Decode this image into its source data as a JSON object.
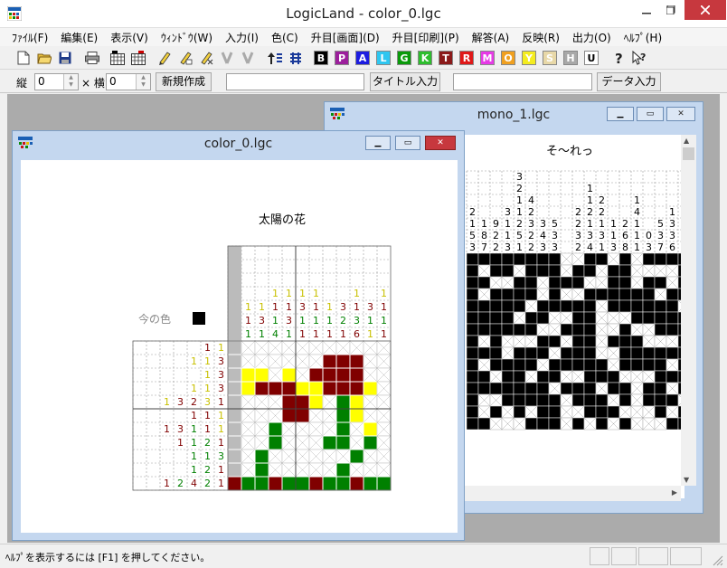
{
  "app": {
    "title": "LogicLand - color_0.lgc"
  },
  "menu": [
    "ﾌｧｲﾙ(F)",
    "編集(E)",
    "表示(V)",
    "ｳｨﾝﾄﾞｳ(W)",
    "入力(I)",
    "色(C)",
    "升目[画面](D)",
    "升目[印刷](P)",
    "解答(A)",
    "反映(R)",
    "出力(O)",
    "ﾍﾙﾌﾟ(H)"
  ],
  "color_buttons": [
    {
      "letter": "B",
      "color": "#000000"
    },
    {
      "letter": "P",
      "color": "#9c1f9c"
    },
    {
      "letter": "A",
      "color": "#1c1ce0"
    },
    {
      "letter": "L",
      "color": "#2ec6f0"
    },
    {
      "letter": "G",
      "color": "#0a9a0a"
    },
    {
      "letter": "K",
      "color": "#2ebd2e"
    },
    {
      "letter": "T",
      "color": "#8b1a1a"
    },
    {
      "letter": "R",
      "color": "#e01818"
    },
    {
      "letter": "M",
      "color": "#e63ae6"
    },
    {
      "letter": "O",
      "color": "#f0a020"
    },
    {
      "letter": "Y",
      "color": "#f4ec20"
    },
    {
      "letter": "S",
      "color": "#e8d8a8"
    },
    {
      "letter": "H",
      "color": "#a8a8a8"
    },
    {
      "letter": "U",
      "color": "#ffffff"
    }
  ],
  "toolbar2": {
    "tate_label": "縦",
    "tate_value": "0",
    "yoko_label": "× 横",
    "yoko_value": "0",
    "new_button": "新規作成",
    "title_input_button": "タイトル入力",
    "data_input_button": "データ入力"
  },
  "mono": {
    "window_title": "mono_1.lgc",
    "puzzle_title": "そ～れっ",
    "col_clue_rows": [
      [
        "",
        "",
        "",
        "",
        "3",
        "",
        "",
        "",
        "",
        "",
        "",
        "",
        "",
        "",
        "",
        "",
        "",
        "",
        ""
      ],
      [
        "",
        "",
        "",
        "",
        "2",
        "",
        "",
        "",
        "",
        "",
        "1",
        "",
        "",
        "",
        "",
        "",
        "",
        "",
        ""
      ],
      [
        "",
        "",
        "",
        "",
        "1",
        "4",
        "",
        "",
        "",
        "",
        "1",
        "2",
        "",
        "",
        "1",
        "",
        "",
        "",
        ""
      ],
      [
        "2",
        "",
        "",
        "3",
        "1",
        "2",
        "",
        "",
        "",
        "2",
        "2",
        "2",
        "",
        "",
        "4",
        "",
        "",
        "1",
        "1",
        "2"
      ],
      [
        "1",
        "1",
        "9",
        "1",
        "2",
        "3",
        "3",
        "5",
        "",
        "2",
        "1",
        "1",
        "1",
        "2",
        "1",
        "",
        "5",
        "3",
        "3"
      ],
      [
        "5",
        "8",
        "2",
        "1",
        "5",
        "2",
        "4",
        "3",
        "",
        "3",
        "3",
        "3",
        "1",
        "6",
        "1",
        "0",
        "3",
        "3"
      ],
      [
        "3",
        "7",
        "2",
        "3",
        "1",
        "2",
        "3",
        "3",
        "",
        "2",
        "4",
        "1",
        "3",
        "8",
        "1",
        "3",
        "7",
        "6"
      ]
    ],
    "cells": [
      "1111111100110101111",
      "1011011101101100001",
      "1100110111001101101",
      "1011110100111111011",
      "1111101111101111110",
      "1111011001100011111",
      "1111110011100100111",
      "1010001101101110001",
      "1110111011100111111",
      "1011110111110111101",
      "1101101100111000111",
      "1111111011101101101",
      "1001111101110101110",
      "1010101100111000101",
      "1100011101010100011"
    ]
  },
  "color": {
    "window_title": "color_0.lgc",
    "puzzle_title": "太陽の花",
    "current_color_label": "今の色",
    "current_color": "#000000",
    "palette": {
      "Y": "#ffff00",
      "T": "#800000",
      "G": "#008000",
      "H": "#bbbbbb",
      "W": "#ffffff"
    },
    "col_clues": [
      [],
      [
        {
          "v": "1",
          "c": "Y"
        },
        {
          "v": "1",
          "c": "T"
        },
        {
          "v": "1",
          "c": "G"
        }
      ],
      [
        {
          "v": "1",
          "c": "Y"
        },
        {
          "v": "3",
          "c": "T"
        },
        {
          "v": "1",
          "c": "G"
        }
      ],
      [
        {
          "v": "1",
          "c": "Y"
        },
        {
          "v": "1",
          "c": "T"
        },
        {
          "v": "1",
          "c": "G"
        },
        {
          "v": "4",
          "c": "G"
        }
      ],
      [
        {
          "v": "1",
          "c": "Y"
        },
        {
          "v": "1",
          "c": "T"
        },
        {
          "v": "3",
          "c": "T"
        },
        {
          "v": "1",
          "c": "G"
        }
      ],
      [
        {
          "v": "1",
          "c": "Y"
        },
        {
          "v": "3",
          "c": "T"
        },
        {
          "v": "1",
          "c": "G"
        },
        {
          "v": "1",
          "c": "T"
        }
      ],
      [
        {
          "v": "1",
          "c": "Y"
        },
        {
          "v": "1",
          "c": "T"
        },
        {
          "v": "1",
          "c": "G"
        },
        {
          "v": "1",
          "c": "T"
        }
      ],
      [
        {
          "v": "1",
          "c": "Y"
        },
        {
          "v": "1",
          "c": "G"
        },
        {
          "v": "1",
          "c": "T"
        }
      ],
      [
        {
          "v": "3",
          "c": "T"
        },
        {
          "v": "2",
          "c": "G"
        },
        {
          "v": "1",
          "c": "T"
        }
      ],
      [
        {
          "v": "1",
          "c": "Y"
        },
        {
          "v": "1",
          "c": "T"
        },
        {
          "v": "3",
          "c": "G"
        },
        {
          "v": "6",
          "c": "T"
        }
      ],
      [
        {
          "v": "3",
          "c": "T"
        },
        {
          "v": "1",
          "c": "G"
        },
        {
          "v": "1",
          "c": "Y"
        }
      ],
      [
        {
          "v": "1",
          "c": "Y"
        },
        {
          "v": "1",
          "c": "T"
        },
        {
          "v": "1",
          "c": "G"
        },
        {
          "v": "1",
          "c": "T"
        }
      ]
    ],
    "row_clues": [
      [
        {
          "v": "1",
          "c": "T"
        },
        {
          "v": "1",
          "c": "Y"
        }
      ],
      [
        {
          "v": "1",
          "c": "Y"
        },
        {
          "v": "1",
          "c": "Y"
        },
        {
          "v": "3",
          "c": "T"
        }
      ],
      [
        {
          "v": "1",
          "c": "Y"
        },
        {
          "v": "3",
          "c": "T"
        }
      ],
      [
        {
          "v": "1",
          "c": "Y"
        },
        {
          "v": "1",
          "c": "Y"
        },
        {
          "v": "3",
          "c": "T"
        }
      ],
      [
        {
          "v": "1",
          "c": "Y"
        },
        {
          "v": "3",
          "c": "T"
        },
        {
          "v": "2",
          "c": "T"
        },
        {
          "v": "3",
          "c": "Y"
        },
        {
          "v": "1",
          "c": "T"
        }
      ],
      [
        {
          "v": "1",
          "c": "T"
        },
        {
          "v": "1",
          "c": "T"
        },
        {
          "v": "1",
          "c": "Y"
        }
      ],
      [
        {
          "v": "1",
          "c": "T"
        },
        {
          "v": "3",
          "c": "T"
        },
        {
          "v": "1",
          "c": "G"
        },
        {
          "v": "1",
          "c": "T"
        },
        {
          "v": "1",
          "c": "Y"
        }
      ],
      [
        {
          "v": "1",
          "c": "T"
        },
        {
          "v": "1",
          "c": "G"
        },
        {
          "v": "2",
          "c": "G"
        },
        {
          "v": "1",
          "c": "T"
        }
      ],
      [
        {
          "v": "1",
          "c": "G"
        },
        {
          "v": "1",
          "c": "G"
        },
        {
          "v": "3",
          "c": "G"
        }
      ],
      [
        {
          "v": "1",
          "c": "G"
        },
        {
          "v": "2",
          "c": "G"
        },
        {
          "v": "1",
          "c": "T"
        }
      ],
      [
        {
          "v": "1",
          "c": "T"
        },
        {
          "v": "2",
          "c": "G"
        },
        {
          "v": "4",
          "c": "T"
        },
        {
          "v": "2",
          "c": "G"
        },
        {
          "v": "1",
          "c": "T"
        }
      ]
    ],
    "cells": [
      "H...........",
      "H......TTT..",
      "HYY.Y.TTTT..",
      "HYTTTYYTTTY.",
      "H...TTY.GY..",
      "H...TT..GY..",
      "H..G....G.Y.",
      "H..G...GG.G.",
      "H.G......G..",
      "H.G.....G...",
      "TGGTGGTGGTGG"
    ]
  },
  "status": {
    "text": "ﾍﾙﾌﾟを表示するには [F1] を押してください。"
  }
}
